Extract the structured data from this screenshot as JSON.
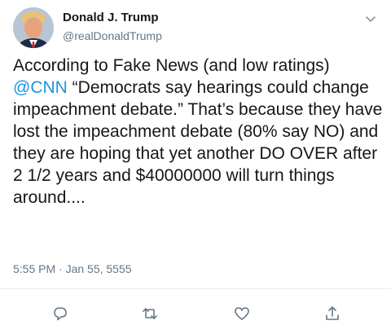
{
  "author": {
    "name": "Donald J. Trump",
    "handle": "@realDonaldTrump"
  },
  "tweet": {
    "text_before": "According to Fake News (and low ratings) ",
    "mention": "@CNN",
    "text_after": " “Democrats say hearings could change impeachment debate.” That’s because they have lost the impeachment debate (80% say NO) and they are hoping that yet another DO OVER after 2 1/2 years and $40000000 will turn things around....",
    "timestamp": "5:55 PM · Jan 55, 5555"
  },
  "actions": {
    "reply_icon": "speech-bubble-icon",
    "retweet_icon": "retweet-arrows-icon",
    "like_icon": "heart-icon",
    "share_icon": "share-upload-icon"
  },
  "colors": {
    "text": "#14171a",
    "secondary": "#657786",
    "link": "#1b95e0",
    "divider": "#e6ecf0"
  }
}
